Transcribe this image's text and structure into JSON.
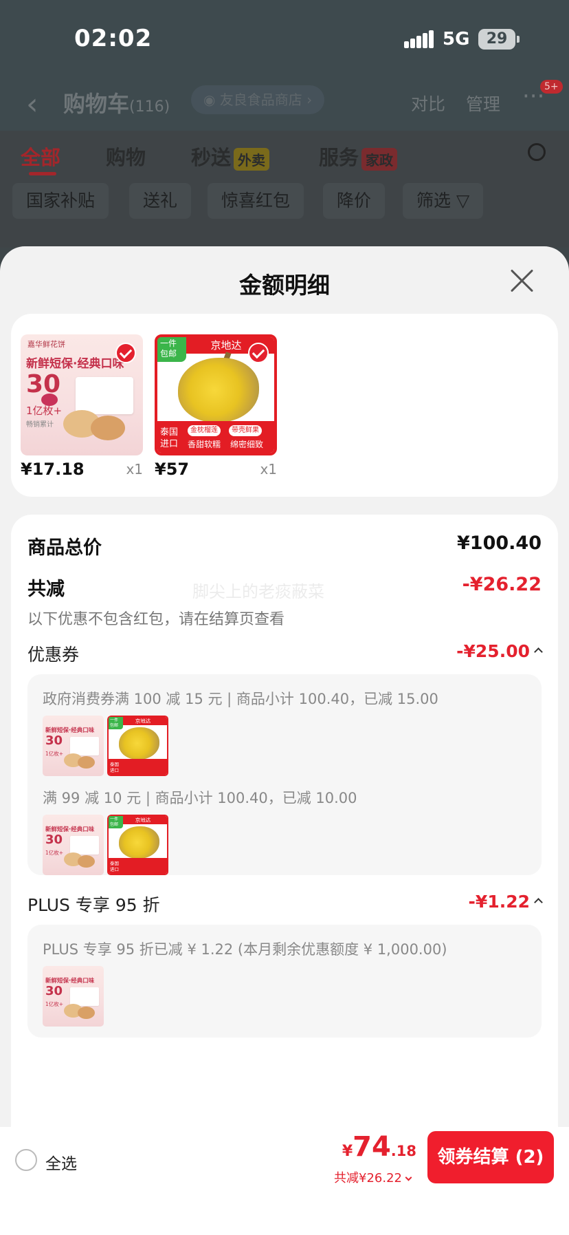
{
  "status_bar": {
    "time": "02:02",
    "network": "5G",
    "battery": "29"
  },
  "cart_header": {
    "back": "‹",
    "title": "购物车",
    "count": "(116)",
    "store": "友良食品商店",
    "compare": "对比",
    "manage": "管理",
    "more": "···",
    "badge": "5+"
  },
  "tabs": [
    {
      "label": "全部"
    },
    {
      "label": "购物"
    },
    {
      "label": "秒送",
      "tag": "外卖"
    },
    {
      "label": "服务",
      "tag": "家政"
    }
  ],
  "chips": [
    "国家补贴",
    "送礼",
    "惊喜红包",
    "降价",
    "筛选"
  ],
  "sheet": {
    "title": "金额明细",
    "products": [
      {
        "name": "pastry",
        "price": "¥17.18",
        "qty": "x1",
        "thumb": {
          "brand": "嘉华鲜花饼",
          "line1": "新鲜短保·经典口味",
          "big": "30",
          "line2": "1亿枚+",
          "line3": "畅销累计"
        }
      },
      {
        "name": "durian",
        "price": "¥57",
        "qty": "x1",
        "thumb": {
          "top": "京地达",
          "corner": "一件包邮",
          "origin": "泰国进口",
          "pill1": "金枕榴莲",
          "pill2": "带壳鲜果",
          "sub1": "香甜软糯",
          "sub2": "绵密细致"
        }
      }
    ],
    "total_label": "商品总价",
    "total_value": "¥100.40",
    "discount_label": "共减",
    "discount_value": "-¥26.22",
    "watermark": "脚尖上的老痰蔽菜",
    "note": "以下优惠不包含红包，请在结算页查看",
    "coupon_section": {
      "label": "优惠券",
      "value": "-¥25.00",
      "lines": [
        "政府消费券满 100 减 15 元 | 商品小计 100.40，已减 15.00",
        "满 99 减 10 元 | 商品小计 100.40，已减 10.00"
      ]
    },
    "plus_section": {
      "label": "PLUS 专享 95 折",
      "value": "-¥1.22",
      "line": "PLUS 专享 95 折已减 ¥ 1.22 (本月剩余优惠额度 ¥ 1,000.00)"
    }
  },
  "bottom_bar": {
    "select_all": "全选",
    "total_yen": "¥",
    "total_int": "74",
    "total_dec": ".18",
    "saved": "共减¥26.22",
    "checkout": "领券结算 (2)"
  },
  "colors": {
    "accent": "#e4212e",
    "checkout": "#f01e2d",
    "durian_frame": "#e31d24",
    "green_tag": "#3bb54a"
  }
}
